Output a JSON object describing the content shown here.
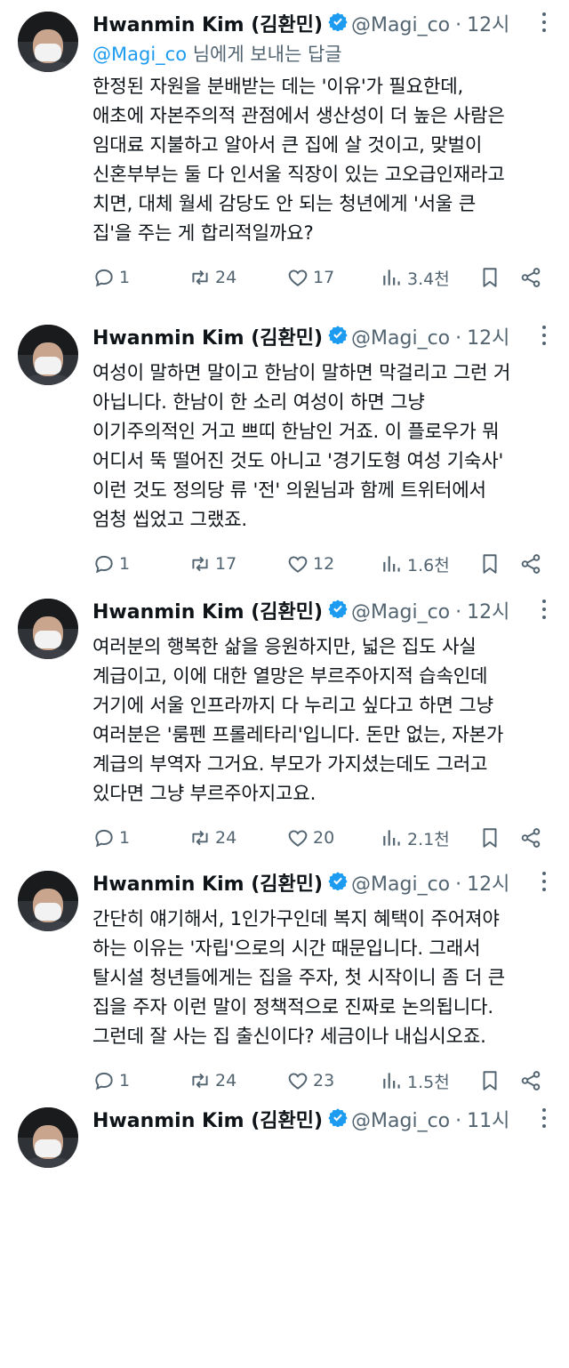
{
  "tweets": [
    {
      "name": "Hwanmin Kim (김환민)",
      "handle": "@Magi_co",
      "dot": "·",
      "time": "12시",
      "reply_mention": "@Magi_co",
      "reply_suffix": " 님에게 보내는 답글",
      "lines": [
        "한정된 자원을 분배받는 데는 '이유'가 필요한데,",
        "애초에 자본주의적 관점에서 생산성이 더 높은 사람은",
        "임대료 지불하고 알아서 큰 집에 살 것이고, 맞벌이",
        "신혼부부는 둘 다 인서울 직장이 있는 고오급인재라고",
        "치면, 대체 월세 감당도 안 되는 청년에게 '서울 큰",
        "집'을 주는 게 합리적일까요?"
      ],
      "replies": "1",
      "retweets": "24",
      "likes": "17",
      "views": "3.4천"
    },
    {
      "name": "Hwanmin Kim (김환민)",
      "handle": "@Magi_co",
      "dot": "·",
      "time": "12시",
      "lines": [
        "여성이 말하면 말이고 한남이 말하면 막걸리고 그런 거",
        "아닙니다. 한남이 한 소리 여성이 하면 그냥",
        "이기주의적인 거고 쁘띠 한남인 거죠. 이 플로우가 뭐",
        "어디서 뚝 떨어진 것도 아니고 '경기도형 여성 기숙사'",
        "이런 것도 정의당 류 '전' 의원님과 함께 트위터에서",
        "엄청 씹었고 그랬죠."
      ],
      "replies": "1",
      "retweets": "17",
      "likes": "12",
      "views": "1.6천"
    },
    {
      "name": "Hwanmin Kim (김환민)",
      "handle": "@Magi_co",
      "dot": "·",
      "time": "12시",
      "lines": [
        "여러분의 행복한 삶을 응원하지만, 넓은 집도 사실",
        "계급이고, 이에 대한 열망은 부르주아지적 습속인데",
        "거기에 서울 인프라까지 다 누리고 싶다고 하면 그냥",
        "여러분은 '룸펜 프롤레타리'입니다. 돈만 없는, 자본가",
        "계급의 부역자 그거요. 부모가 가지셨는데도 그러고",
        "있다면 그냥 부르주아지고요."
      ],
      "replies": "1",
      "retweets": "24",
      "likes": "20",
      "views": "2.1천"
    },
    {
      "name": "Hwanmin Kim (김환민)",
      "handle": "@Magi_co",
      "dot": "·",
      "time": "12시",
      "lines": [
        "간단히 얘기해서, 1인가구인데 복지 혜택이 주어져야",
        "하는 이유는 '자립'으로의 시간 때문입니다. 그래서",
        "탈시설 청년들에게는 집을 주자, 첫 시작이니 좀 더 큰",
        "집을 주자 이런 말이 정책적으로 진짜로 논의됩니다.",
        "그런데 잘 사는 집 출신이다? 세금이나 내십시오죠."
      ],
      "replies": "1",
      "retweets": "24",
      "likes": "23",
      "views": "1.5천"
    },
    {
      "name": "Hwanmin Kim (김환민)",
      "handle": "@Magi_co",
      "dot": "·",
      "time": "11시"
    }
  ],
  "icons": {
    "reply": "reply-icon",
    "retweet": "retweet-icon",
    "like": "heart-icon",
    "views": "views-icon",
    "bookmark": "bookmark-icon",
    "share": "share-icon",
    "verified": "verified-badge-icon",
    "more": "more-icon"
  },
  "colors": {
    "text": "#0f1419",
    "secondary": "#536471",
    "link": "#1d9bf0",
    "verified": "#1d9bf0"
  }
}
